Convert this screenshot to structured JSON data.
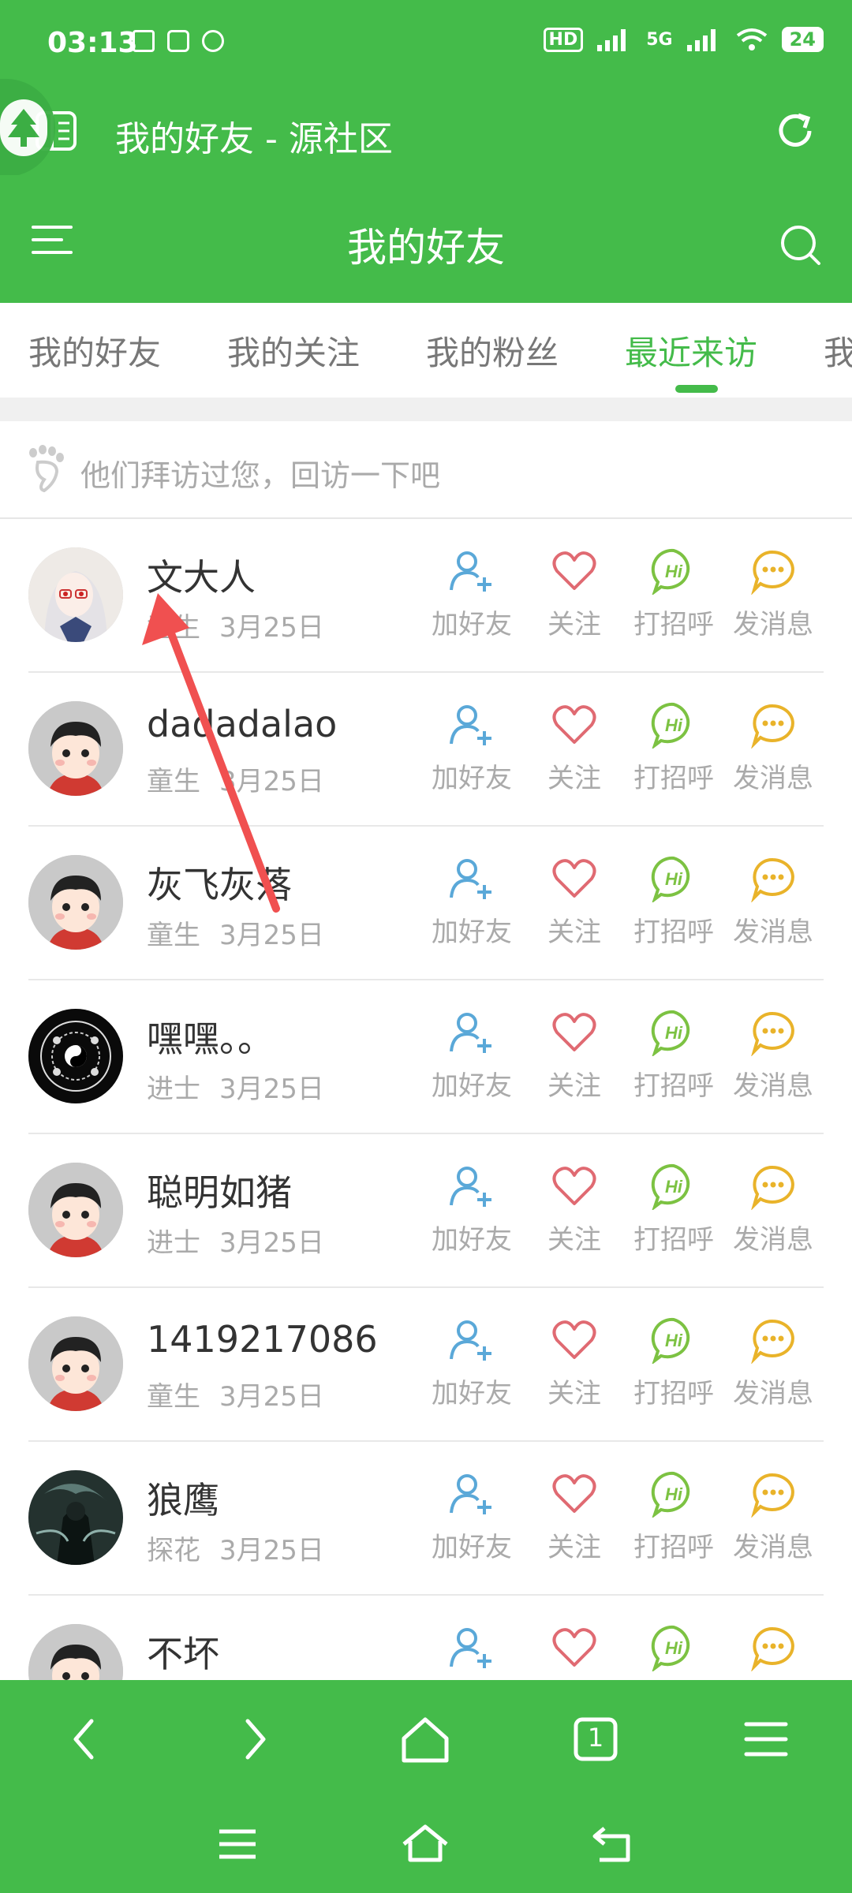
{
  "status_bar": {
    "time": "03:13",
    "network_label": "5G",
    "battery": "24"
  },
  "title_bar": {
    "window_title": "我的好友 - 源社区"
  },
  "header": {
    "page_title": "我的好友"
  },
  "tabs": [
    {
      "label": "我的好友",
      "active": false
    },
    {
      "label": "我的关注",
      "active": false
    },
    {
      "label": "我的粉丝",
      "active": false
    },
    {
      "label": "最近来访",
      "active": true
    },
    {
      "label": "我",
      "active": false
    }
  ],
  "hint": {
    "text": "他们拜访过您，回访一下吧"
  },
  "actions": {
    "add_friend": "加好友",
    "follow": "关注",
    "greet": "打招呼",
    "message": "发消息"
  },
  "visitors": [
    {
      "name": "文大人",
      "rank": "童生",
      "date": "3月25日",
      "avatar": "anime-girl"
    },
    {
      "name": "dadadalao",
      "rank": "童生",
      "date": "3月25日",
      "avatar": "default"
    },
    {
      "name": "灰飞灰落",
      "rank": "童生",
      "date": "3月25日",
      "avatar": "default"
    },
    {
      "name": "嘿嘿。。",
      "rank": "进士",
      "date": "3月25日",
      "avatar": "taiji"
    },
    {
      "name": "聪明如猪",
      "rank": "进士",
      "date": "3月25日",
      "avatar": "default"
    },
    {
      "name": "1419217086",
      "rank": "童生",
      "date": "3月25日",
      "avatar": "default"
    },
    {
      "name": "狼鹰",
      "rank": "探花",
      "date": "3月25日",
      "avatar": "dark-warrior"
    },
    {
      "name": "不坏",
      "rank": "",
      "date": "",
      "avatar": "default"
    }
  ],
  "toolbar": {
    "tab_count": "1"
  },
  "colors": {
    "brand_green": "#44bb4a",
    "add_friend_blue": "#5aa8d8",
    "follow_red": "#e06a72",
    "greet_green": "#7cc242",
    "message_yellow": "#e9b32a"
  }
}
